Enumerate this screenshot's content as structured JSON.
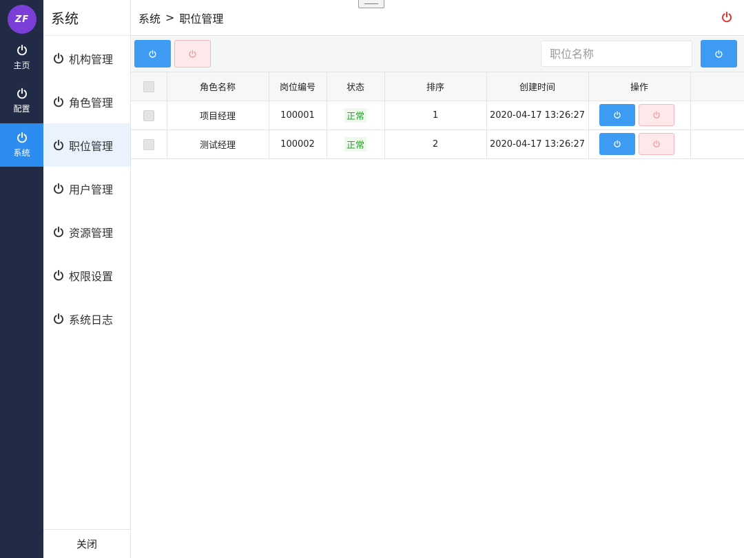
{
  "logo": {
    "text": "ZF"
  },
  "rail": {
    "items": [
      {
        "label": "主页",
        "icon": "power-icon"
      },
      {
        "label": "配置",
        "icon": "power-icon"
      },
      {
        "label": "系统",
        "icon": "power-icon",
        "active": true
      }
    ]
  },
  "sidebar": {
    "title": "系统",
    "items": [
      {
        "label": "机构管理"
      },
      {
        "label": "角色管理"
      },
      {
        "label": "职位管理",
        "active": true
      },
      {
        "label": "用户管理"
      },
      {
        "label": "资源管理"
      },
      {
        "label": "权限设置"
      },
      {
        "label": "系统日志"
      }
    ],
    "close_label": "关闭"
  },
  "header": {
    "breadcrumb": [
      "系统",
      "职位管理"
    ],
    "separator": ">"
  },
  "toolbar": {
    "search_placeholder": "职位名称"
  },
  "table": {
    "columns": [
      "",
      "角色名称",
      "岗位编号",
      "状态",
      "排序",
      "创建时间",
      "操作",
      ""
    ],
    "rows": [
      {
        "name": "项目经理",
        "code": "100001",
        "status": "正常",
        "order": "1",
        "created": "2020-04-17 13:26:27"
      },
      {
        "name": "测试经理",
        "code": "100002",
        "status": "正常",
        "order": "2",
        "created": "2020-04-17 13:26:27"
      }
    ]
  },
  "colors": {
    "rail_bg": "#222b45",
    "accent_blue": "#3d9bf4",
    "active_rail": "#2d8cf0",
    "danger_pink_bg": "#fde9ea",
    "danger_red": "#e0302a",
    "logo_purple": "#7b3fd8",
    "status_green": "#2f9b2f"
  }
}
